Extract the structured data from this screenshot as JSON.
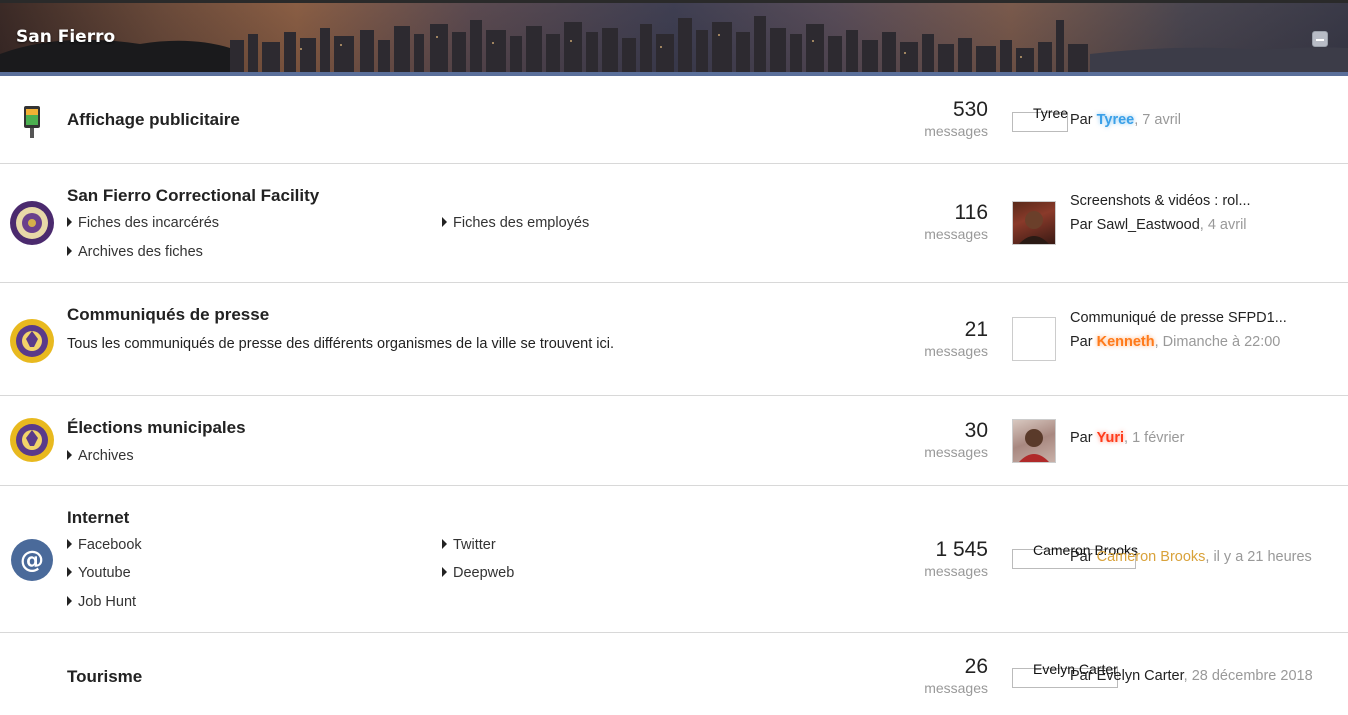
{
  "category": {
    "title": "San Fierro"
  },
  "forums": [
    {
      "title": "Affichage publicitaire",
      "icon": "billboard-icon",
      "count": "530",
      "count_label": "messages",
      "last": {
        "avatar_alt": "Tyree",
        "topic": "",
        "by_prefix": "Par",
        "author": "Tyree",
        "author_color": "#3aa0e8",
        "date": ", 7 avril"
      }
    },
    {
      "title": "San Fierro Correctional Facility",
      "icon": "correctional-seal-icon",
      "subforums": [
        "Fiches des incarcérés",
        "Fiches des employés",
        "Archives des fiches"
      ],
      "count": "116",
      "count_label": "messages",
      "last": {
        "avatar_alt": "",
        "topic": "Screenshots & vidéos : rol...",
        "by_prefix": "Par",
        "author": "Sawl_Eastwood",
        "date": ", 4 avril"
      }
    },
    {
      "title": "Communiqués de presse",
      "icon": "city-seal-icon",
      "description": "Tous les communiqués de presse des différents organismes de la ville se trouvent ici.",
      "count": "21",
      "count_label": "messages",
      "last": {
        "avatar_alt": "",
        "topic": "Communiqué de presse SFPD1...",
        "by_prefix": "Par",
        "author": "Kenneth",
        "author_color": "#ff7a1a",
        "date": ", Dimanche à 22:00"
      }
    },
    {
      "title": "Élections municipales",
      "icon": "city-seal-icon",
      "subforums": [
        "Archives"
      ],
      "count": "30",
      "count_label": "messages",
      "last": {
        "avatar_alt": "",
        "topic": "",
        "by_prefix": "Par",
        "author": "Yuri",
        "author_color": "#ff3b1a",
        "date": ", 1 février"
      }
    },
    {
      "title": "Internet",
      "icon": "at-sign-icon",
      "subforums": [
        "Facebook",
        "Twitter",
        "Youtube",
        "Deepweb",
        "Job Hunt"
      ],
      "count": "1 545",
      "count_label": "messages",
      "last": {
        "avatar_alt": "Cameron Brooks",
        "topic": "",
        "by_prefix": "Par",
        "author": "Cameron Brooks",
        "author_color": "#d9a23a",
        "date": ", il y a 21 heures"
      }
    },
    {
      "title": "Tourisme",
      "icon": "",
      "count": "26",
      "count_label": "messages",
      "last": {
        "avatar_alt": "Evelyn Carter",
        "topic": "",
        "by_prefix": "Par",
        "author": "Evelyn Carter",
        "date": ", 28 décembre 2018"
      }
    }
  ]
}
